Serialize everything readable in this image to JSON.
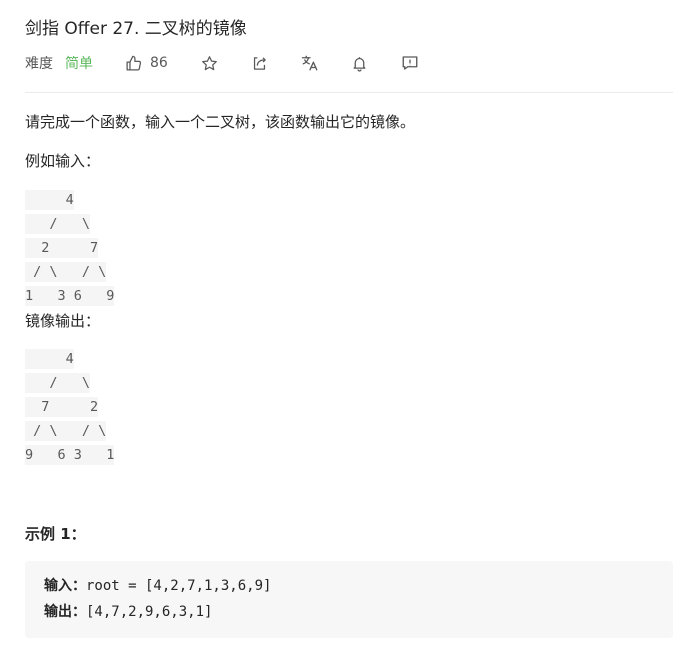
{
  "problem": {
    "title": "剑指 Offer 27. 二叉树的镜像",
    "difficulty_label": "难度",
    "difficulty_value": "简单",
    "likes": "86",
    "icons": [
      "thumbs-up-icon",
      "star-icon",
      "share-icon",
      "translate-icon",
      "bell-icon",
      "feedback-icon"
    ],
    "colors": {
      "easy": "#5cb85c",
      "code_bg": "#f5f5f5",
      "example_bg": "#f7f7f7"
    }
  },
  "description": {
    "text": "请完成一个函数，输入一个二叉树，该函数输出它的镜像。",
    "input_label": "例如输入：",
    "input_tree": [
      "     4",
      "   /   \\",
      "  2     7",
      " / \\   / \\",
      "1   3 6   9"
    ],
    "output_label": "镜像输出：",
    "output_tree": [
      "     4",
      "   /   \\",
      "  7     2",
      " / \\   / \\",
      "9   6 3   1"
    ]
  },
  "example": {
    "title": "示例 1：",
    "input_label": "输入：",
    "input_value": "root = [4,2,7,1,3,6,9]",
    "output_label": "输出：",
    "output_value": "[4,7,2,9,6,3,1]"
  }
}
